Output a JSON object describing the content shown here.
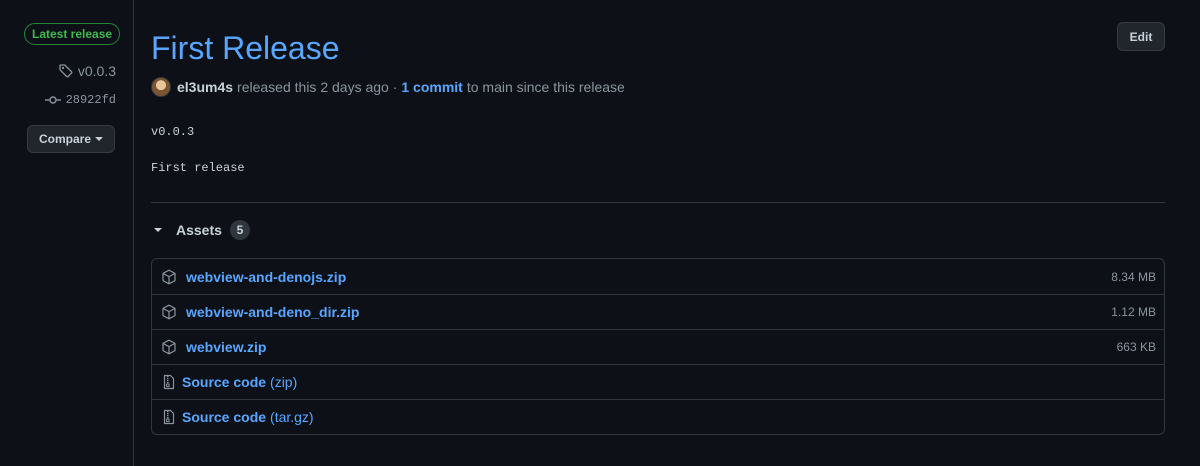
{
  "sidebar": {
    "latest_badge": "Latest release",
    "tag": "v0.0.3",
    "commit": "28922fd",
    "compare_label": "Compare"
  },
  "release": {
    "title": "First Release",
    "edit_label": "Edit",
    "author": "el3um4s",
    "released_text": "released this 2 days ago ·",
    "commits_link": "1 commit",
    "commits_suffix": "to main since this release",
    "body": [
      "v0.0.3",
      "First release"
    ]
  },
  "assets": {
    "header": "Assets",
    "count": "5",
    "items": [
      {
        "icon": "package-icon",
        "name": "webview-and-denojs.zip",
        "size": "8.34 MB"
      },
      {
        "icon": "package-icon",
        "name": "webview-and-deno_dir.zip",
        "size": "1.12 MB"
      },
      {
        "icon": "package-icon",
        "name": "webview.zip",
        "size": "663 KB"
      },
      {
        "icon": "file-zip-icon",
        "name": "Source code",
        "suffix": "(zip)"
      },
      {
        "icon": "file-zip-icon",
        "name": "Source code",
        "suffix": "(tar.gz)"
      }
    ]
  },
  "colors": {
    "background": "#0d1117",
    "link": "#58a6ff",
    "latest_green": "#3fb950",
    "border": "#30363d",
    "muted": "#8b949e"
  }
}
